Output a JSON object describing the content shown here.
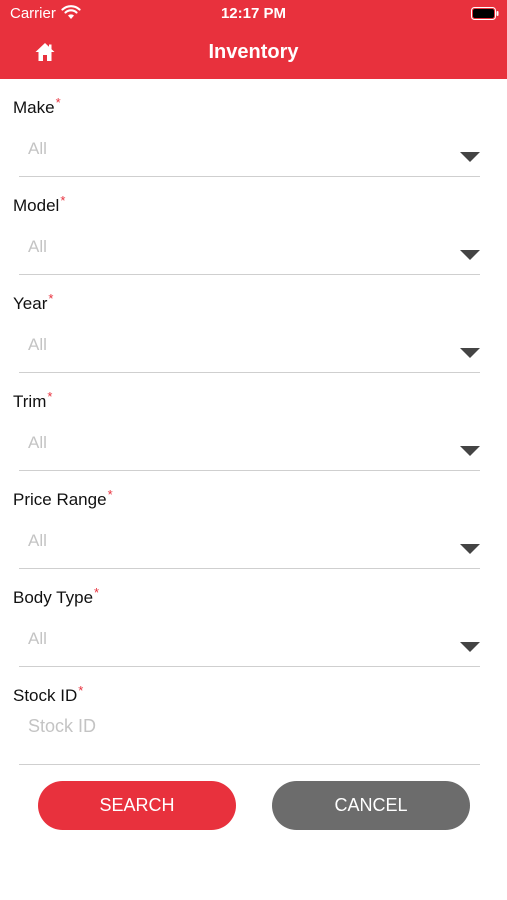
{
  "status_bar": {
    "carrier": "Carrier",
    "time": "12:17 PM",
    "wifi_icon": "wifi-icon",
    "battery_icon": "battery-icon"
  },
  "nav": {
    "title": "Inventory",
    "home_icon": "home-icon"
  },
  "colors": {
    "accent": "#e8313d",
    "cancel": "#6c6c6c",
    "placeholder": "#c4c4c4"
  },
  "form": {
    "required_mark": "*",
    "fields": [
      {
        "label": "Make",
        "value": "All"
      },
      {
        "label": "Model",
        "value": "All"
      },
      {
        "label": "Year",
        "value": "All"
      },
      {
        "label": "Trim",
        "value": "All"
      },
      {
        "label": "Price Range",
        "value": "All"
      },
      {
        "label": "Body Type",
        "value": "All"
      }
    ],
    "stock": {
      "label": "Stock ID",
      "placeholder": "Stock ID"
    }
  },
  "buttons": {
    "search": "SEARCH",
    "cancel": "CANCEL"
  }
}
